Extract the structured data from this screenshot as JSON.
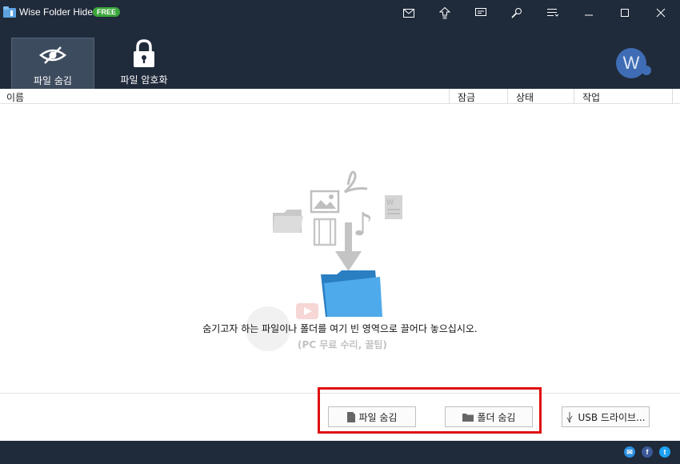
{
  "window": {
    "title": "Wise Folder Hider",
    "badge": "FREE"
  },
  "titlebar_icons": [
    "mail-icon",
    "upgrade-icon",
    "feedback-icon",
    "settings-icon",
    "menu-icon",
    "minimize-icon",
    "maximize-icon",
    "close-icon"
  ],
  "toolbar": {
    "tabs": [
      {
        "label": "파일 숨김",
        "icon": "hidden-eye-icon",
        "active": true
      },
      {
        "label": "파일 암호화",
        "icon": "lock-icon",
        "active": false
      }
    ],
    "logo": "W"
  },
  "table": {
    "columns": [
      "이름",
      "잠금",
      "상태",
      "작업"
    ]
  },
  "drop_area": {
    "hint": "숨기고자 하는 파일이나 폴더를 여기 빈 영역으로 끌어다 놓으십시오.",
    "watermark": "(PC 무료 수리, 꿀팁)"
  },
  "actions": {
    "hide_file": "파일 숨김",
    "hide_folder": "폴더 숨김",
    "usb": "USB 드라이브..."
  },
  "footer": {
    "social": [
      "email-icon",
      "facebook-icon",
      "twitter-icon"
    ]
  },
  "colors": {
    "chrome": "#1f2a3a",
    "active_tab": "#3d4b5e",
    "highlight": "#e01010",
    "badge": "#3aa53a",
    "logo": "#3f6db5"
  }
}
